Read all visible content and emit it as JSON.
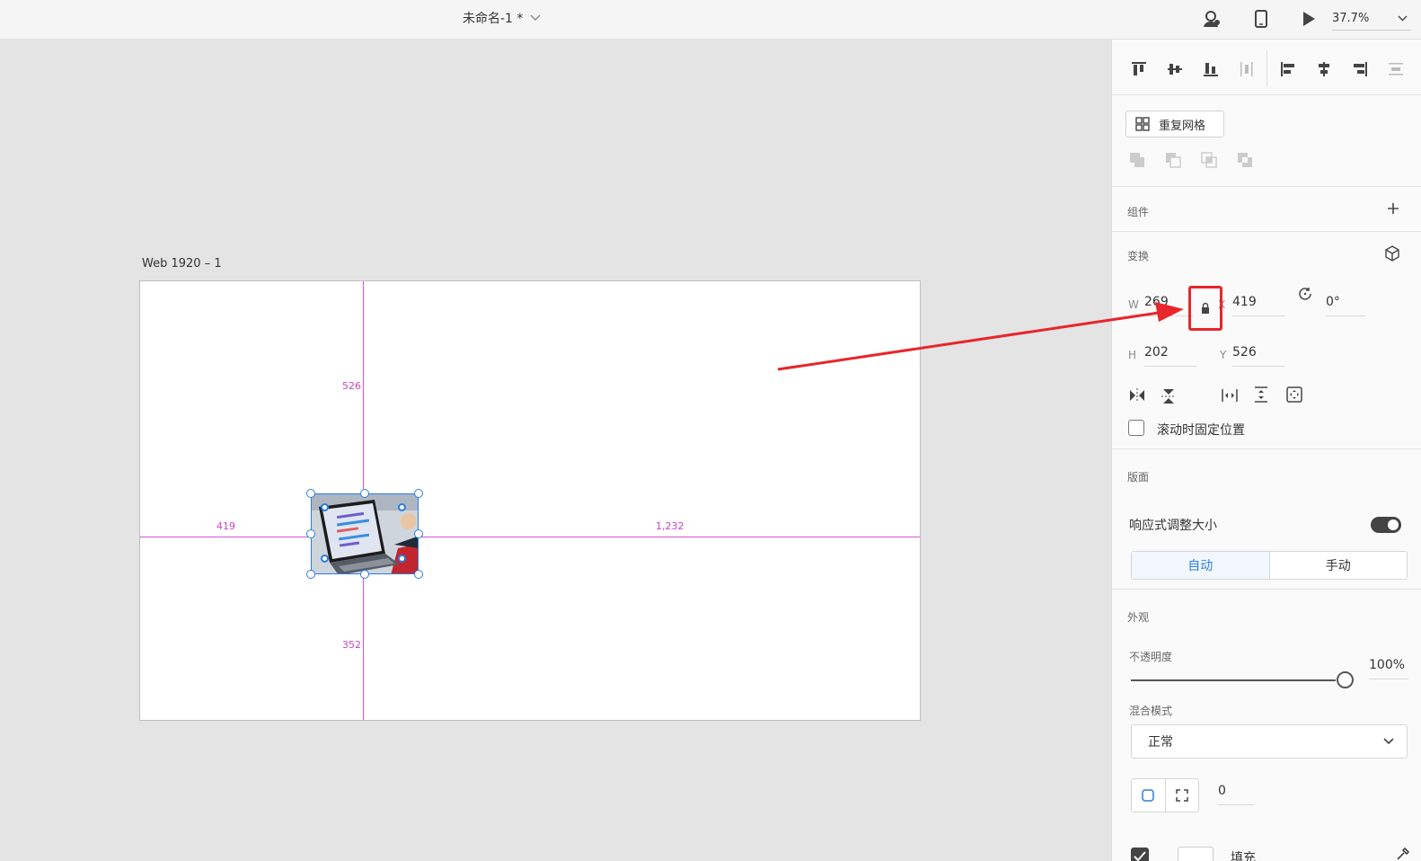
{
  "header": {
    "doc_title": "未命名-1 *",
    "zoom": "37.7%"
  },
  "canvas": {
    "artboard_label": "Web 1920 – 1",
    "measure_top": "526",
    "measure_left": "419",
    "measure_right": "1,232",
    "measure_bottom": "352"
  },
  "panel": {
    "repeat_grid_label": "重复网格",
    "components_title": "组件",
    "transform_title": "变换",
    "w_label": "W",
    "w_value": "269",
    "h_label": "H",
    "h_value": "202",
    "x_label": "X",
    "x_value": "419",
    "y_label": "Y",
    "y_value": "526",
    "rotation_value": "0°",
    "fix_position_label": "滚动时固定位置",
    "layout_title": "版面",
    "responsive_label": "响应式调整大小",
    "seg_auto": "自动",
    "seg_manual": "手动",
    "appearance_title": "外观",
    "opacity_label": "不透明度",
    "opacity_value": "100%",
    "opacity_level": 1.0,
    "blend_label": "混合模式",
    "blend_value": "正常",
    "corner_value": "0",
    "fill_label": "填充"
  },
  "colors": {
    "guide": "#d94fd4",
    "selection": "#2a7de1",
    "highlight": "#e8262b"
  }
}
